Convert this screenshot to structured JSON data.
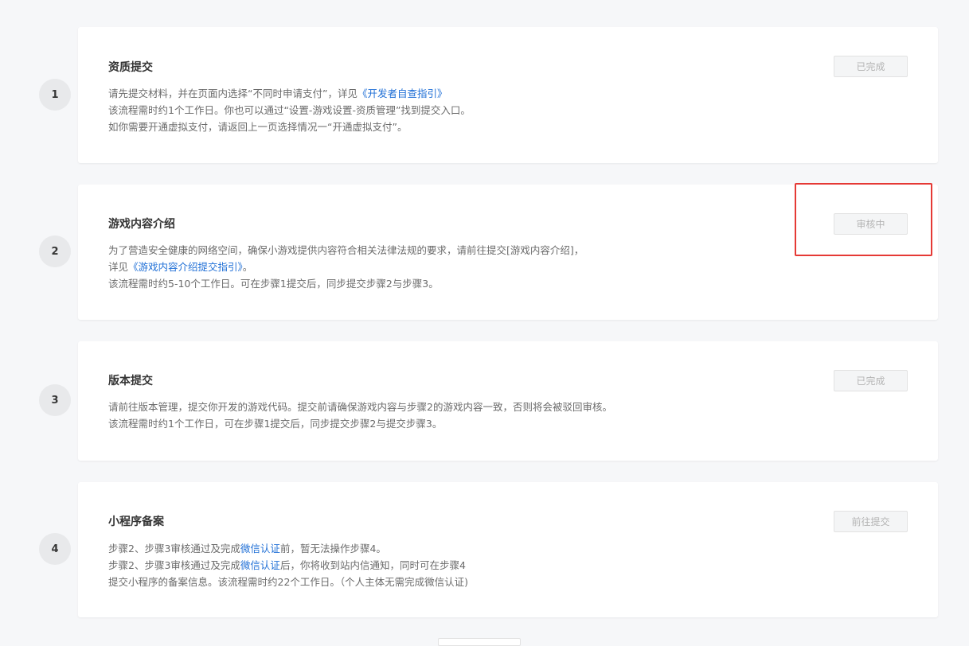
{
  "steps": [
    {
      "number": "1",
      "title": "资质提交",
      "status": "已完成",
      "lines": [
        {
          "pre": "请先提交材料，并在页面内选择“不同时申请支付”，详见",
          "link": "《开发者自查指引》",
          "post": ""
        },
        {
          "text": "该流程需时约1个工作日。你也可以通过“设置-游戏设置-资质管理”找到提交入口。"
        },
        {
          "text": "如你需要开通虚拟支付，请返回上一页选择情况一“开通虚拟支付”。"
        }
      ]
    },
    {
      "number": "2",
      "title": "游戏内容介绍",
      "status": "审核中",
      "lines": [
        {
          "text": "为了营造安全健康的网络空间，确保小游戏提供内容符合相关法律法规的要求，请前往提交[游戏内容介绍]，"
        },
        {
          "pre": "详见",
          "link": "《游戏内容介绍提交指引》",
          "post": "。"
        },
        {
          "text": "该流程需时约5-10个工作日。可在步骤1提交后，同步提交步骤2与步骤3。"
        }
      ]
    },
    {
      "number": "3",
      "title": "版本提交",
      "status": "已完成",
      "lines": [
        {
          "text": "请前往版本管理，提交你开发的游戏代码。提交前请确保游戏内容与步骤2的游戏内容一致，否则将会被驳回审核。"
        },
        {
          "text": "该流程需时约1个工作日，可在步骤1提交后，同步提交步骤2与提交步骤3。"
        }
      ]
    },
    {
      "number": "4",
      "title": "小程序备案",
      "status": "前往提交",
      "lines": [
        {
          "pre": "步骤2、步骤3审核通过及完成",
          "link": "微信认证",
          "post": "前，暂无法操作步骤4。"
        },
        {
          "pre": "步骤2、步骤3审核通过及完成",
          "link": "微信认证",
          "post": "后，你将收到站内信通知，同时可在步骤4"
        },
        {
          "text": "提交小程序的备案信息。该流程需时约22个工作日。（个人主体无需完成微信认证)"
        }
      ]
    }
  ],
  "colors": {
    "link": "#1f6fd6",
    "highlight": "#e53935",
    "background": "#f6f7f9"
  }
}
